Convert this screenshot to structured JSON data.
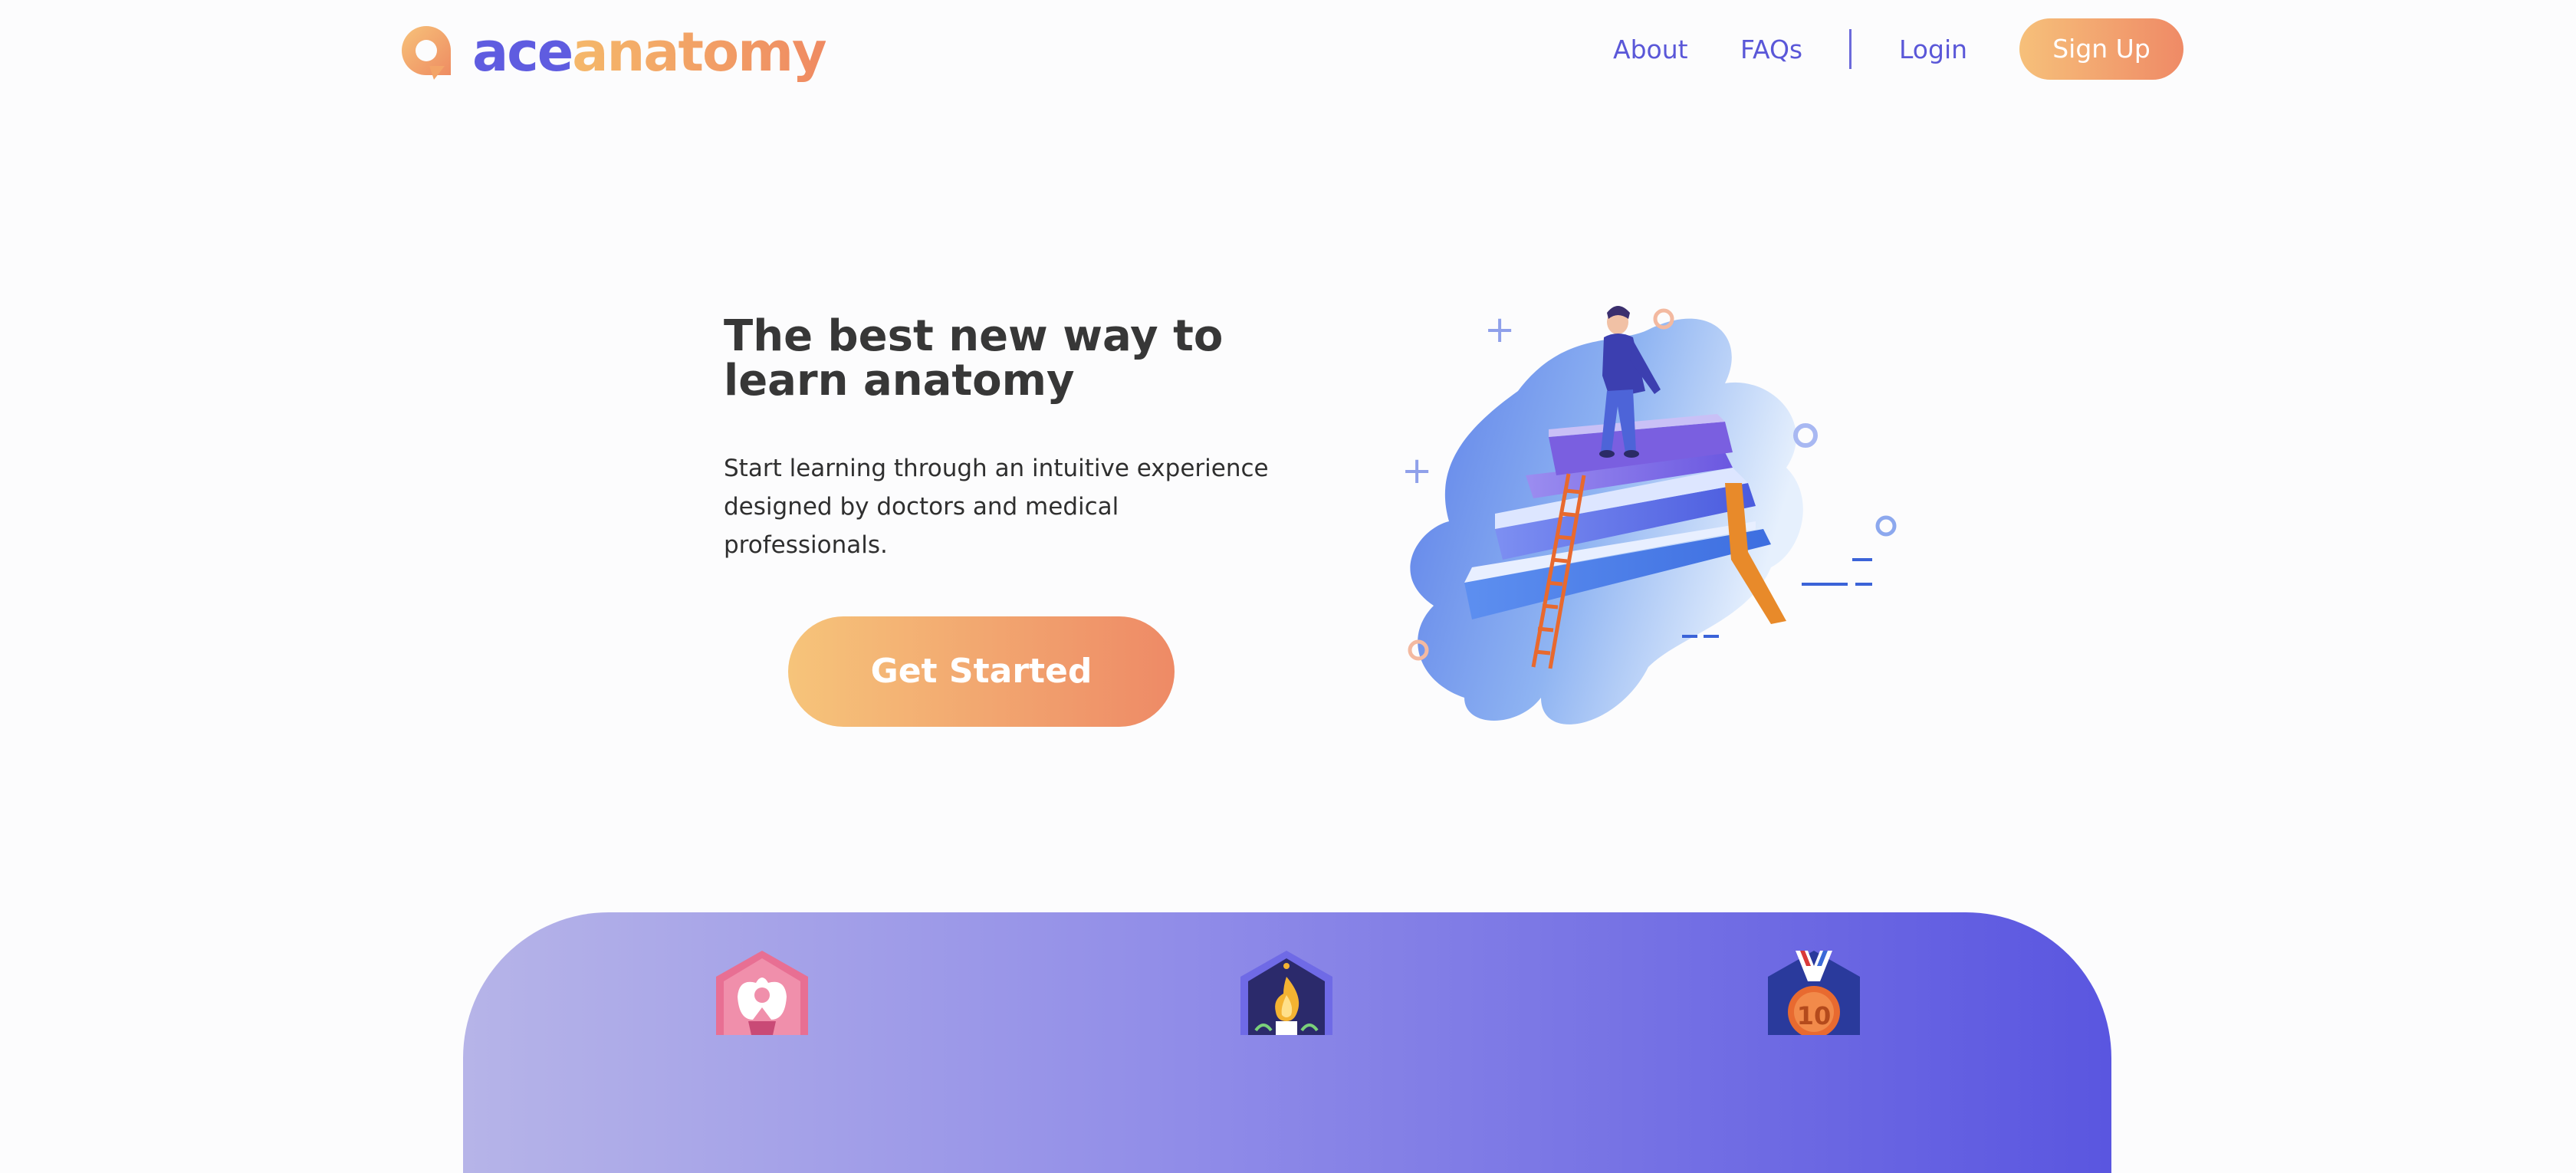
{
  "brand": {
    "name_part1": "ace",
    "name_part2": "anatomy",
    "logo_icon": "logo-a-icon"
  },
  "nav": {
    "about": "About",
    "faqs": "FAQs",
    "login": "Login",
    "signup": "Sign Up"
  },
  "hero": {
    "title": "The best new way to learn anatomy",
    "description": "Start learning through an intuitive experience designed by doctors and medical professionals.",
    "cta": "Get Started",
    "illustration": "person-on-books-illustration"
  },
  "features": {
    "badges": [
      "pelvis-badge-icon",
      "flame-badge-icon",
      "medal-badge-icon"
    ]
  },
  "colors": {
    "primary": "#5f5ce0",
    "accent_start": "#f6c07a",
    "accent_end": "#ef8a66",
    "background": "#fcfcfd"
  }
}
